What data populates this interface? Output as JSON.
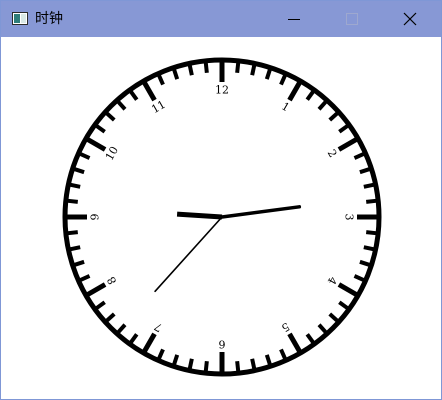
{
  "window": {
    "title": "时钟"
  },
  "controls": {
    "minimize_icon": "minimize-icon",
    "maximize_icon": "maximize-icon",
    "close_icon": "close-icon"
  },
  "clock": {
    "numerals": [
      "12",
      "1",
      "2",
      "3",
      "4",
      "5",
      "6",
      "7",
      "8",
      "9",
      "10",
      "11"
    ],
    "time": {
      "hour": 2,
      "minute": 45,
      "second": 37
    },
    "colors": {
      "face": "#ffffff",
      "ink": "#000000",
      "titlebar": "#8798d5"
    }
  }
}
